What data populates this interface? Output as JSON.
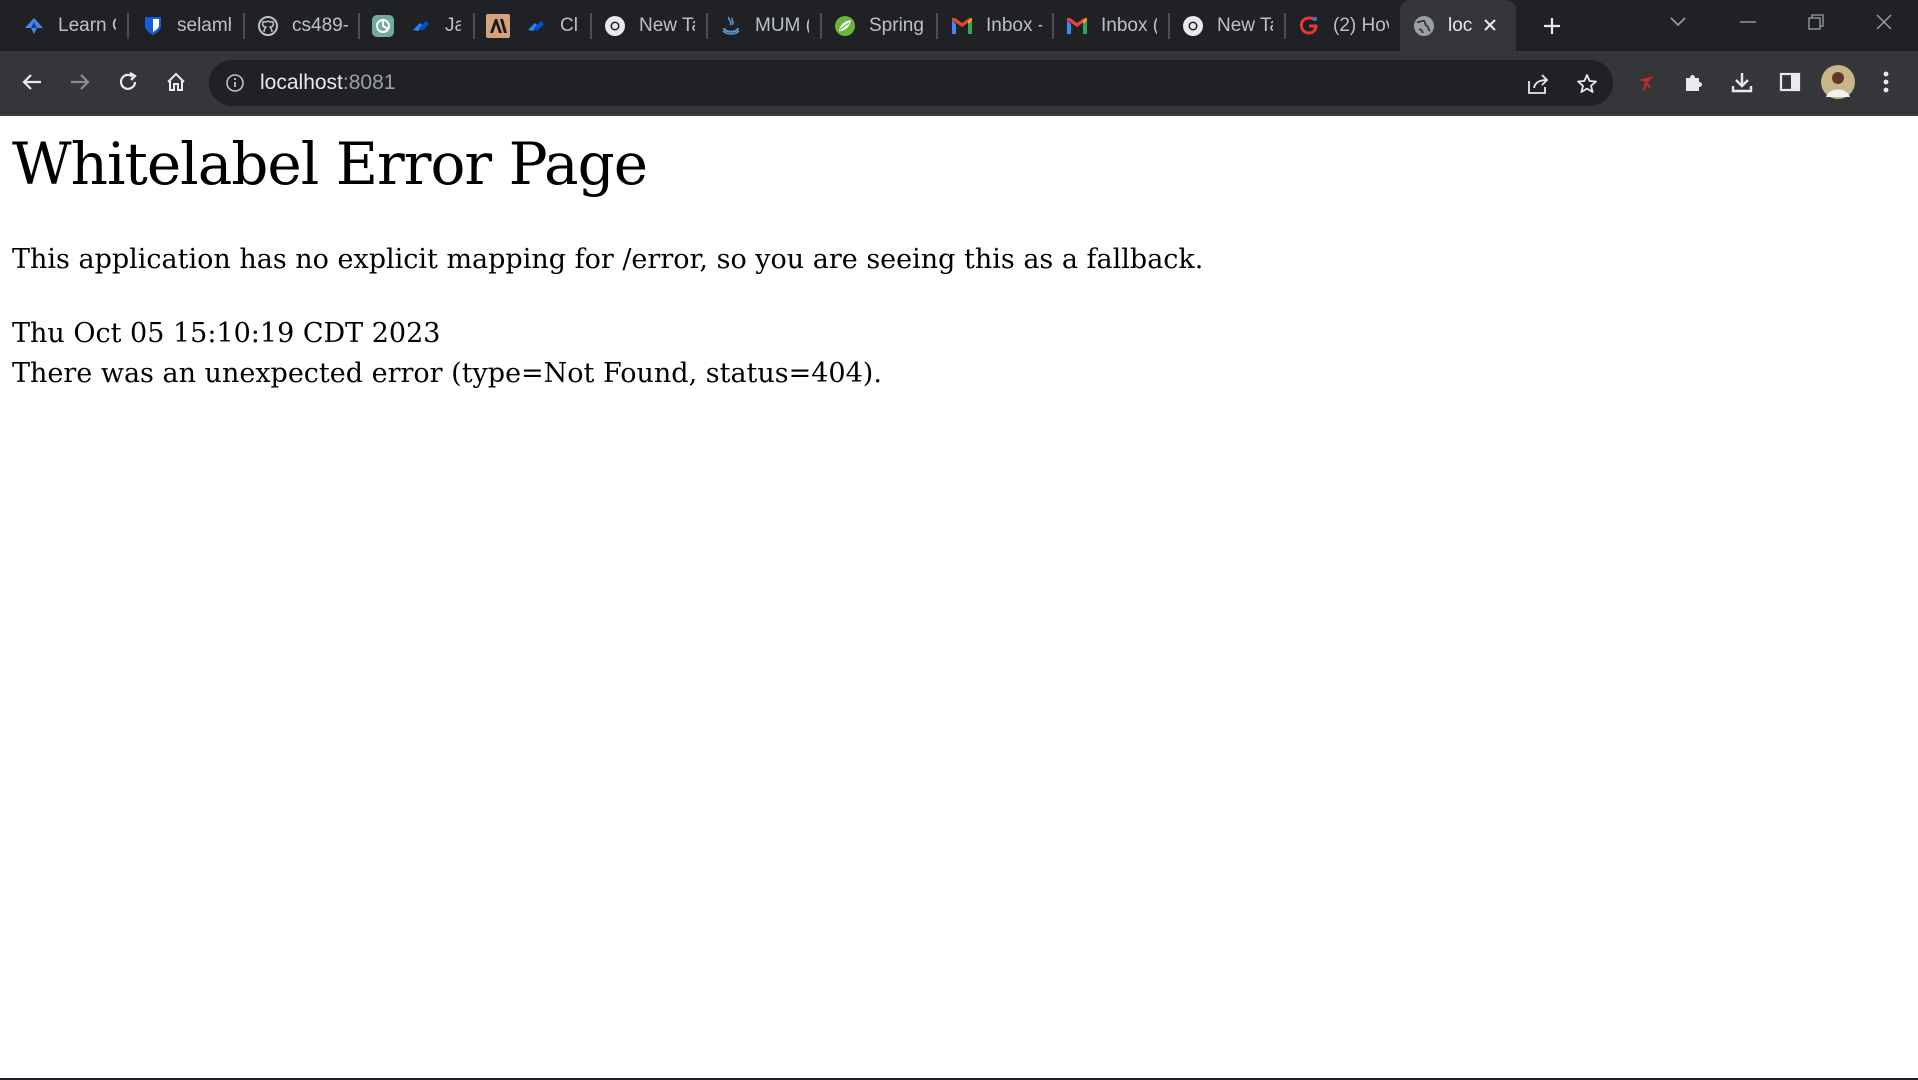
{
  "browser": {
    "tabs": [
      {
        "title": "Learn C",
        "icon": "learn-icon"
      },
      {
        "title": "selamh",
        "icon": "bitwarden-icon"
      },
      {
        "title": "cs489-",
        "icon": "github-icon"
      },
      {
        "title": "",
        "icon": "chatgpt-icon"
      },
      {
        "title": "Jav",
        "icon": "jira-icon"
      },
      {
        "title": "",
        "icon": "anthropic-icon"
      },
      {
        "title": "Cla",
        "icon": "jira-icon"
      },
      {
        "title": "New Ta",
        "icon": "chrome-icon"
      },
      {
        "title": "MUM (",
        "icon": "java-icon"
      },
      {
        "title": "Spring",
        "icon": "spring-icon"
      },
      {
        "title": "Inbox -",
        "icon": "gmail-icon"
      },
      {
        "title": "Inbox (",
        "icon": "gmail-icon"
      },
      {
        "title": "New Ta",
        "icon": "chrome-icon"
      },
      {
        "title": "(2) Hov",
        "icon": "app-icon"
      },
      {
        "title": "loc",
        "icon": "globe-icon",
        "active": true
      }
    ],
    "address": {
      "host": "localhost",
      "port": ":8081"
    }
  },
  "page": {
    "heading": "Whitelabel Error Page",
    "message": "This application has no explicit mapping for /error, so you are seeing this as a fallback.",
    "timestamp": "Thu Oct 05 15:10:19 CDT 2023",
    "error": "There was an unexpected error (type=Not Found, status=404)."
  },
  "colors": {
    "tabstrip": "#202124",
    "toolbar": "#35363a",
    "omnibox": "#202124",
    "page_background": "#ffffff"
  }
}
